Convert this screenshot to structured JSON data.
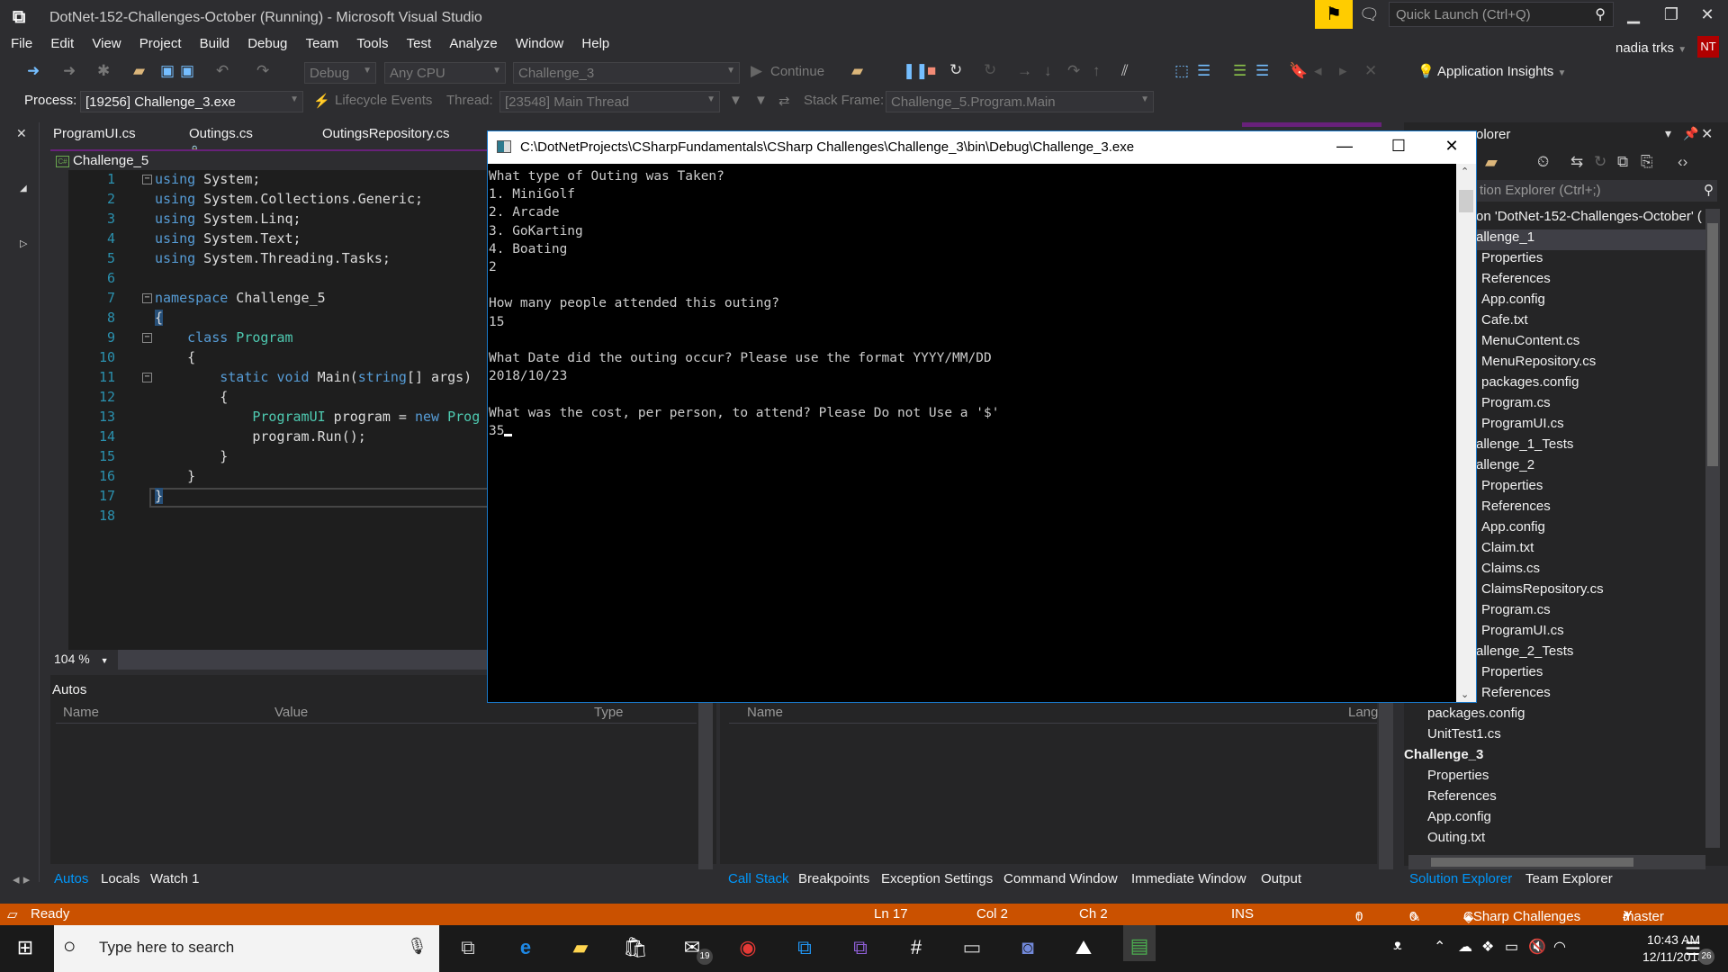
{
  "window": {
    "title": "DotNet-152-Challenges-October (Running) - Microsoft Visual Studio",
    "quick_launch_placeholder": "Quick Launch (Ctrl+Q)",
    "user_name": "nadia trks",
    "user_initials": "NT"
  },
  "menu": [
    "File",
    "Edit",
    "View",
    "Project",
    "Build",
    "Debug",
    "Team",
    "Tools",
    "Test",
    "Analyze",
    "Window",
    "Help"
  ],
  "toolbar": {
    "configuration": "Debug",
    "platform": "Any CPU",
    "startup_project": "Challenge_3",
    "continue_label": "Continue",
    "app_insights_label": "Application Insights"
  },
  "debug_location": {
    "process_label": "Process:",
    "process_value": "[19256] Challenge_3.exe",
    "lifecycle_label": "Lifecycle Events",
    "thread_label": "Thread:",
    "thread_value": "[23548] Main Thread",
    "stack_frame_label": "Stack Frame:",
    "stack_frame_value": "Challenge_5.Program.Main"
  },
  "document_tabs": [
    {
      "label": "ProgramUI.cs"
    },
    {
      "label": "Outings.cs",
      "locked": true
    },
    {
      "label": "OutingsRepository.cs"
    }
  ],
  "editor": {
    "navigation_scope": "Challenge_5",
    "zoom_level": "104 %",
    "lines": [
      {
        "n": "1"
      },
      {
        "n": "2"
      },
      {
        "n": "3"
      },
      {
        "n": "4"
      },
      {
        "n": "5"
      },
      {
        "n": "6"
      },
      {
        "n": "7"
      },
      {
        "n": "8"
      },
      {
        "n": "9"
      },
      {
        "n": "10"
      },
      {
        "n": "11"
      },
      {
        "n": "12"
      },
      {
        "n": "13"
      },
      {
        "n": "14"
      },
      {
        "n": "15"
      },
      {
        "n": "16"
      },
      {
        "n": "17"
      },
      {
        "n": "18"
      }
    ],
    "code": {
      "l1a": "using",
      "l1b": " System;",
      "l2a": "using",
      "l2b": " System.Collections.Generic;",
      "l3a": "using",
      "l3b": " System.Linq;",
      "l4a": "using",
      "l4b": " System.Text;",
      "l5a": "using",
      "l5b": " System.Threading.Tasks;",
      "l7a": "namespace",
      "l7b": " Challenge_5",
      "l8": "{",
      "l9a": "    class",
      "l9b": " Program",
      "l10": "    {",
      "l11a": "        static void",
      "l11b": " Main(",
      "l11c": "string",
      "l11d": "[] args)",
      "l12": "        {",
      "l13a": "            ProgramUI",
      "l13b": " program = ",
      "l13c": "new",
      "l13d": " Prog",
      "l14": "            program.Run();",
      "l15": "        }",
      "l16": "    }",
      "l17": "}"
    }
  },
  "console": {
    "title": "C:\\DotNetProjects\\CSharpFundamentals\\CSharp Challenges\\Challenge_3\\bin\\Debug\\Challenge_3.exe",
    "output": "What type of Outing was Taken?\n1. MiniGolf\n2. Arcade\n3. GoKarting\n4. Boating\n2\n\nHow many people attended this outing?\n15\n\nWhat Date did the outing occur? Please use the format YYYY/MM/DD\n2018/10/23\n\nWhat was the cost, per person, to attend? Please Do not Use a '$'\n35"
  },
  "autos": {
    "title": "Autos",
    "columns": [
      "Name",
      "Value",
      "Type"
    ],
    "tabs": [
      {
        "label": "Autos",
        "active": true
      },
      {
        "label": "Locals"
      },
      {
        "label": "Watch 1"
      }
    ]
  },
  "call_stack": {
    "columns": [
      "Name",
      "Lang"
    ],
    "tabs": [
      {
        "label": "Call Stack",
        "active": true
      },
      {
        "label": "Breakpoints"
      },
      {
        "label": "Exception Settings"
      },
      {
        "label": "Command Window"
      },
      {
        "label": "Immediate Window"
      },
      {
        "label": "Output"
      }
    ]
  },
  "solution_explorer": {
    "title": "olorer",
    "search_placeholder": "tion Explorer (Ctrl+;)",
    "items": [
      {
        "label": "on 'DotNet-152-Challenges-October' (",
        "level": 0
      },
      {
        "label": "allenge_1",
        "level": 0,
        "selected": true
      },
      {
        "label": "Properties",
        "level": 1
      },
      {
        "label": "References",
        "level": 1
      },
      {
        "label": "App.config",
        "level": 1
      },
      {
        "label": "Cafe.txt",
        "level": 1
      },
      {
        "label": "MenuContent.cs",
        "level": 1
      },
      {
        "label": "MenuRepository.cs",
        "level": 1
      },
      {
        "label": "packages.config",
        "level": 1
      },
      {
        "label": "Program.cs",
        "level": 1
      },
      {
        "label": "ProgramUI.cs",
        "level": 1
      },
      {
        "label": "allenge_1_Tests",
        "level": 0
      },
      {
        "label": "allenge_2",
        "level": 0
      },
      {
        "label": "Properties",
        "level": 1
      },
      {
        "label": "References",
        "level": 1
      },
      {
        "label": "App.config",
        "level": 1
      },
      {
        "label": "Claim.txt",
        "level": 1
      },
      {
        "label": "Claims.cs",
        "level": 1
      },
      {
        "label": "ClaimsRepository.cs",
        "level": 1
      },
      {
        "label": "Program.cs",
        "level": 1
      },
      {
        "label": "ProgramUI.cs",
        "level": 1
      },
      {
        "label": "allenge_2_Tests",
        "level": 0
      },
      {
        "label": "Properties",
        "level": 1
      },
      {
        "label": "References",
        "level": 1
      },
      {
        "label": "packages.config",
        "level": 1
      },
      {
        "label": "UnitTest1.cs",
        "level": 1
      },
      {
        "label": "Challenge_3",
        "level": 0
      },
      {
        "label": "Properties",
        "level": 1
      },
      {
        "label": "References",
        "level": 1
      },
      {
        "label": "App.config",
        "level": 1
      },
      {
        "label": "Outing.txt",
        "level": 1
      }
    ],
    "tabs": [
      {
        "label": "Solution Explorer",
        "active": true
      },
      {
        "label": "Team Explorer"
      }
    ]
  },
  "status_bar": {
    "state": "Ready",
    "line": "Ln 17",
    "col": "Col 2",
    "ch": "Ch 2",
    "mode": "INS",
    "pushes": "0",
    "changes": "0",
    "repo": "CSharp Challenges",
    "branch": "master"
  },
  "taskbar": {
    "search_placeholder": "Type here to search",
    "mail_badge": "19",
    "time": "10:43 AM",
    "date": "12/11/2018",
    "notification_count": "26"
  }
}
